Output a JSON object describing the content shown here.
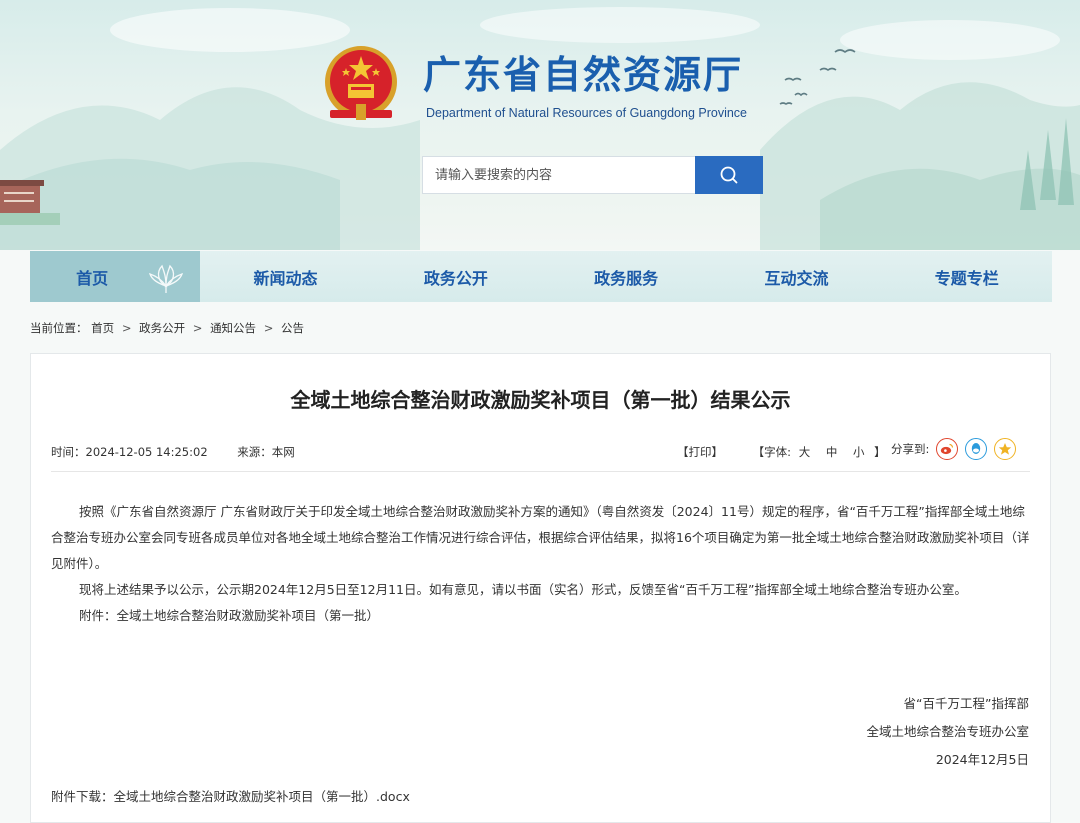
{
  "header": {
    "title": "广东省自然资源厅",
    "subtitle": "Department of Natural Resources of Guangdong Province"
  },
  "search": {
    "placeholder": "请输入要搜索的内容",
    "icon": "search-icon"
  },
  "nav": {
    "items": [
      {
        "label": "首页",
        "active": true
      },
      {
        "label": "新闻动态"
      },
      {
        "label": "政务公开"
      },
      {
        "label": "政务服务"
      },
      {
        "label": "互动交流"
      },
      {
        "label": "专题专栏"
      }
    ]
  },
  "breadcrumb": {
    "prefix": "当前位置：",
    "items": [
      "首页",
      "政务公开",
      "通知公告",
      "公告"
    ],
    "separator": ">"
  },
  "article": {
    "title": "全域土地综合整治财政激励奖补项目（第一批）结果公示",
    "time": "时间：2024-12-05 14:25:02",
    "source": "来源：本网",
    "print": "【打印】",
    "font_label": "【字体:",
    "font_large": "大",
    "font_medium": "中",
    "font_small": "小",
    "font_close": "】",
    "share_label": "分享到:",
    "paragraphs": [
      "按照《广东省自然资源厅 广东省财政厅关于印发全域土地综合整治财政激励奖补方案的通知》（粤自然资发〔2024〕11号）规定的程序，省“百千万工程”指挥部全域土地综合整治专班办公室会同专班各成员单位对各地全域土地综合整治工作情况进行综合评估，根据综合评估结果，拟将16个项目确定为第一批全域土地综合整治财政激励奖补项目（详见附件）。",
      "现将上述结果予以公示，公示期2024年12月5日至12月11日。如有意见，请以书面（实名）形式，反馈至省“百千万工程”指挥部全域土地综合整治专班办公室。",
      "附件：全域土地综合整治财政激励奖补项目（第一批）"
    ],
    "sign_org1": "省“百千万工程”指挥部",
    "sign_org2": "全域土地综合整治专班办公室",
    "sign_date": "2024年12月5日",
    "attach_label": "附件下载：",
    "attach_file": "全域土地综合整治财政激励奖补项目（第一批）.docx"
  },
  "colors": {
    "brand_blue": "#1a5fae",
    "search_button": "#2a6bc0",
    "nav_active": "#9ec9cf",
    "weibo": "#e0452d",
    "qq": "#2b9bdc",
    "qzone": "#f0b323"
  }
}
